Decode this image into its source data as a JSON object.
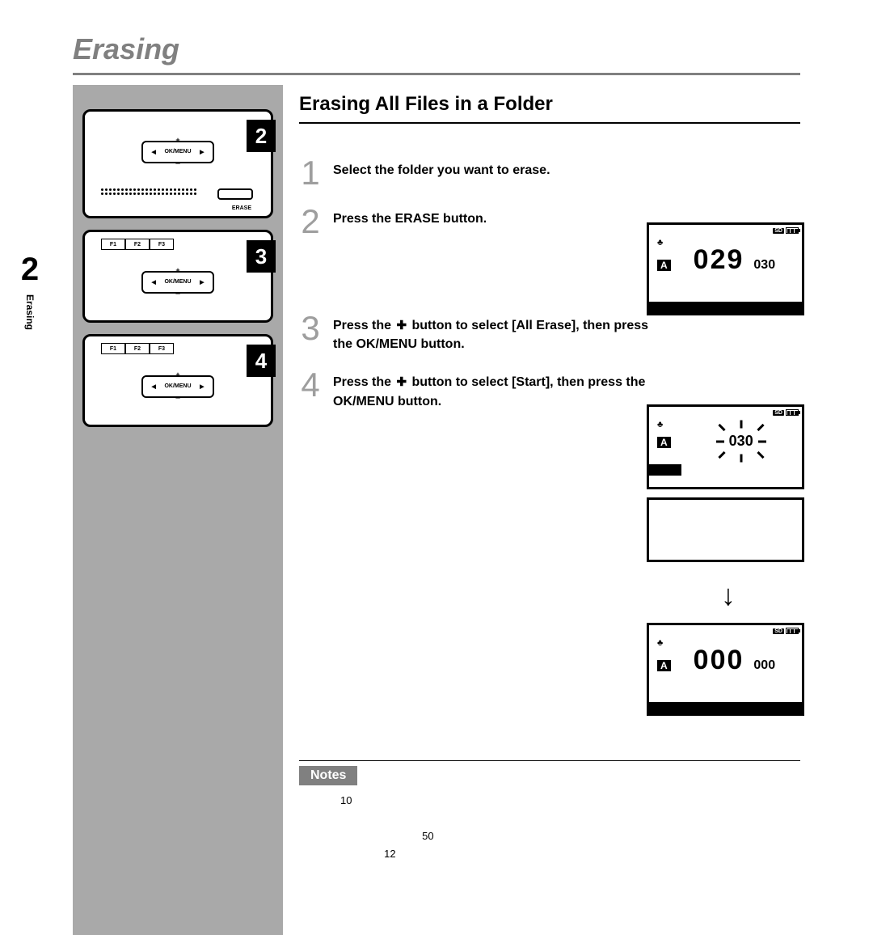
{
  "page": {
    "title": "Erasing",
    "section_title": "Erasing All Files in a Folder"
  },
  "side_tab": {
    "number": "2",
    "label": "Erasing"
  },
  "device": {
    "ok_label": "OK/MENU",
    "erase_label": "ERASE",
    "fkeys": [
      "F1",
      "F2",
      "F3"
    ],
    "badges": [
      "2",
      "3",
      "4"
    ]
  },
  "steps": [
    {
      "num": "1",
      "text": "Select the folder you want to erase."
    },
    {
      "num": "2",
      "text_pre": "Press the ",
      "kw": "ERASE",
      "text_post": " button."
    },
    {
      "num": "3",
      "text_pre": "Press the ",
      "plus": "✚",
      "mid": " button to select [All Erase], then press the ",
      "kw": "OK/MENU",
      "text_post": " button."
    },
    {
      "num": "4",
      "text_pre": "Press the ",
      "plus": "✚",
      "mid": " button to select [Start], then press the ",
      "kw": "OK/MENU",
      "text_post": " button."
    }
  ],
  "lcd": {
    "sd": "SD",
    "folder": "A",
    "screen1": {
      "big": "029",
      "small": "030"
    },
    "screen2": {
      "flash": "030"
    },
    "screen3": {
      "big": "000",
      "small": "000"
    }
  },
  "notes": {
    "heading": "Notes",
    "n1": "10",
    "n2": "50",
    "n3": "12"
  }
}
